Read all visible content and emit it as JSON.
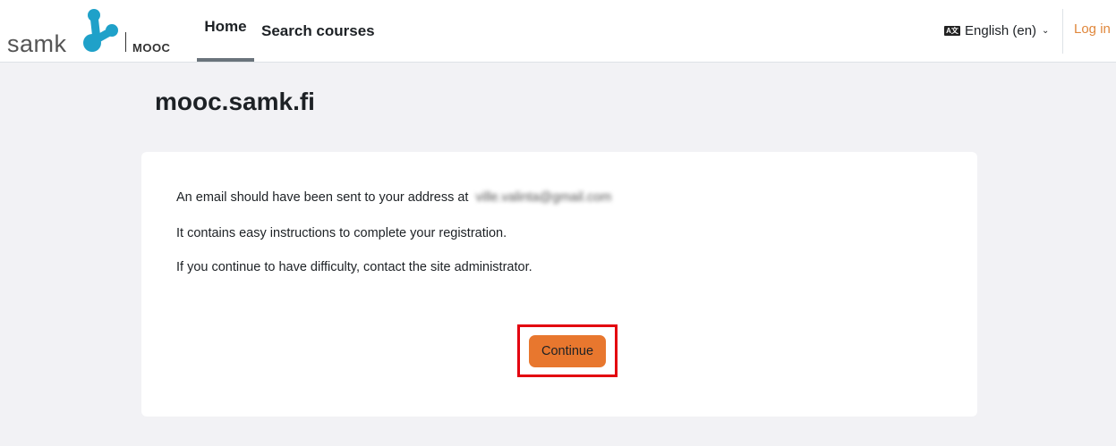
{
  "header": {
    "brand_name": "samk",
    "brand_sub": "MOOC",
    "nav": {
      "home": "Home",
      "search_courses": "Search courses"
    },
    "language": "English (en)",
    "language_icon": "language-icon",
    "login": "Log in"
  },
  "main": {
    "title": "mooc.samk.fi",
    "messages": {
      "line1": "An email should have been sent to your address at",
      "email": "ville.valinta@gmail.com",
      "line2": "It contains easy instructions to complete your registration.",
      "line3": "If you continue to have difficulty, contact the site administrator."
    },
    "continue_label": "Continue"
  },
  "colors": {
    "accent": "#e8772e",
    "login_link": "#e0873b",
    "highlight": "#e3000f",
    "logo": "#1fa1c9",
    "background": "#f2f2f5"
  }
}
